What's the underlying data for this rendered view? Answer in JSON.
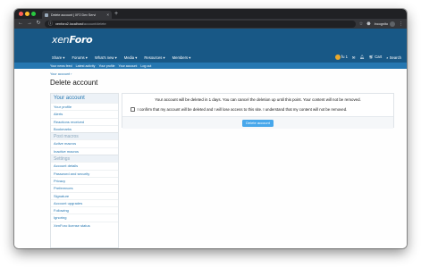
{
  "browser": {
    "tab_title": "Delete account | XF2 Dev Servi",
    "tab_close": "×",
    "new_tab": "+",
    "url_host": "xenforo2.localhost",
    "url_path": "/account/delete",
    "incognito_label": "Incognito",
    "icons": [
      "back-icon",
      "forward-icon",
      "reload-icon",
      "star-icon",
      "extension-icon",
      "menu-icon"
    ]
  },
  "header": {
    "logo_light": "xen",
    "logo_bold": "Foro"
  },
  "nav": {
    "tabs": [
      {
        "label": "Share ▾"
      },
      {
        "label": "Forums ▾"
      },
      {
        "label": "What's new ▾"
      },
      {
        "label": "Media ▾"
      },
      {
        "label": "Resources ▾"
      },
      {
        "label": "Members ▾"
      }
    ],
    "user_label": "fu 1",
    "cart_label": "Cart",
    "search_label": "Search"
  },
  "subnav": {
    "items": [
      "Your news feed",
      "Latest activity",
      "Your profile",
      "Your account",
      "Log out"
    ]
  },
  "breadcrumb": "Your account ›",
  "page_title": "Delete account",
  "sidebar": {
    "head": "Your account",
    "group1": [
      "Your profile",
      "Alerts",
      "Reactions received",
      "Bookmarks"
    ],
    "section2": "Post macros",
    "group2": [
      "Active macros",
      "Inactive macros"
    ],
    "section3": "Settings",
    "group3": [
      "Account details",
      "Password and security",
      "Privacy",
      "Preferences",
      "Signature",
      "Account upgrades",
      "Following",
      "Ignoring",
      "XenForo license status"
    ]
  },
  "panel": {
    "notice": "Your account will be deleted in 1 days. You can cancel the deletion up until this point. Your content will not be removed.",
    "confirm_label": "I confirm that my account will be deleted and I will lose access to this site. I understand that my content will not be removed.",
    "button_label": "Delete account"
  },
  "colors": {
    "header": "#185886",
    "accent": "#2577b1",
    "button": "#47a7eb"
  }
}
